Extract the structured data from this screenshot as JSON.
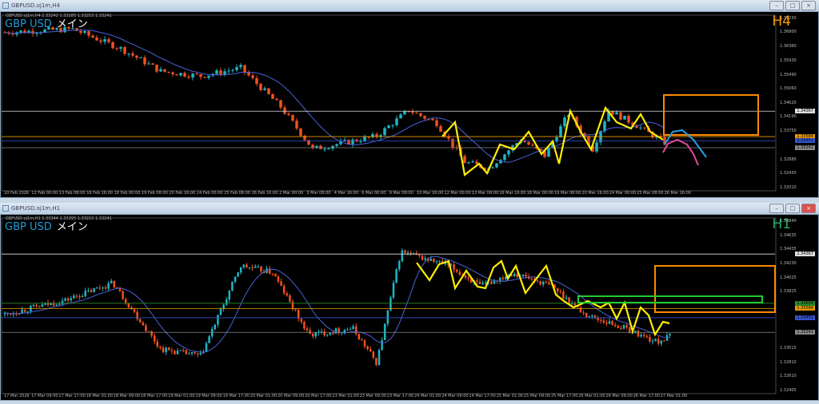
{
  "top": {
    "window_title": "GBPUSD.oj1m,H4",
    "info": "GBPUSD.oj1m,H4  1.33242 1.33285 1.33215 1.33241",
    "symbol": "GBP USD",
    "label": "メイン",
    "timeframe": "H4",
    "prices": [
      "1.37230",
      "1.36800",
      "1.36360",
      "1.35930",
      "1.35490",
      "1.35060",
      "1.34620",
      "1.34190",
      "1.33750",
      "1.32880",
      "1.32450",
      "1.32010"
    ],
    "tags": {
      "white": "1.34367",
      "orange": "1.33584",
      "blue": "1.33451",
      "gray": "1.33241"
    },
    "times": [
      "10 Feb 2026",
      "12 Feb 00:00",
      "13 Feb 08:00",
      "16 Feb 16:00",
      "18 Feb 00:00",
      "19 Feb 08:00",
      "20 Feb 16:00",
      "24 Feb 00:00",
      "25 Feb 08:00",
      "26 Feb 16:00",
      "2 Mar 00:00",
      "3 Mar 08:00",
      "4 Mar 16:00",
      "6 Mar 00:00",
      "9 Mar 08:00",
      "10 Mar 16:00",
      "12 Mar 00:00",
      "13 Mar 08:00",
      "16 Mar 16:00",
      "18 Mar 00:00",
      "19 Mar 08:00",
      "20 Mar 16:00",
      "24 Mar 00:00",
      "25 Mar 08:00",
      "26 Mar 16:00"
    ]
  },
  "bottom": {
    "window_title": "GBPUSD.oj1m,H1",
    "info": "GBPUSD.oj1m,H1  1.33344 1.33395 1.33215 1.33241",
    "symbol": "GBP USD",
    "label": "メイン",
    "timeframe": "H1",
    "prices": [
      "1.34840",
      "1.34635",
      "1.34435",
      "1.34230",
      "1.34025",
      "1.33825",
      "1.33015",
      "1.32810",
      "1.32610",
      "1.32405"
    ],
    "tags": {
      "white": "1.34367",
      "green": "1.33659",
      "orange": "1.33584",
      "blue": "1.33451",
      "gray": "1.33241"
    },
    "times": [
      "17 Mar 2026",
      "17 Mar 09:00",
      "17 Mar 17:00",
      "18 Mar 01:00",
      "18 Mar 09:00",
      "18 Mar 17:00",
      "19 Mar 01:00",
      "19 Mar 09:00",
      "19 Mar 17:00",
      "20 Mar 01:00",
      "20 Mar 09:00",
      "20 Mar 17:00",
      "23 Mar 01:00",
      "23 Mar 09:00",
      "23 Mar 17:00",
      "24 Mar 01:00",
      "24 Mar 09:00",
      "24 Mar 17:00",
      "25 Mar 01:00",
      "25 Mar 09:00",
      "25 Mar 17:00",
      "26 Mar 01:00",
      "26 Mar 09:00",
      "26 Mar 17:00",
      "27 Mar 01:00"
    ]
  },
  "colors": {
    "bull": "#1fb5c4",
    "bear": "#f0511e",
    "ma": "#4a62d8",
    "zigzag": "#ffee00",
    "box": "#ff8800",
    "green": "#22cc33",
    "pink": "#e84a9a"
  }
}
